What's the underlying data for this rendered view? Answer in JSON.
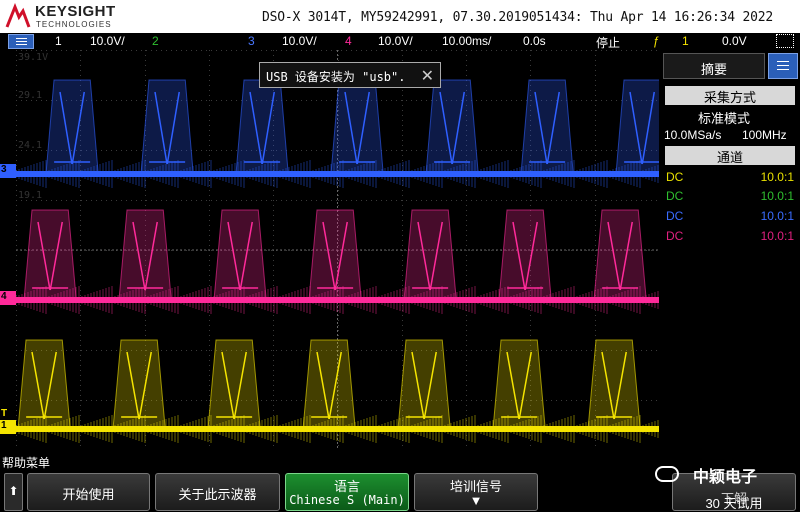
{
  "header": {
    "brand": "KEYSIGHT",
    "brand_sub": "TECHNOLOGIES",
    "info": "DSO-X 3014T, MY59242991, 07.30.2019051434: Thu Apr 14 16:26:34 2022"
  },
  "channel_bar": {
    "ch1_num": "1",
    "ch1_scale": "10.0V/",
    "ch2_num": "2",
    "ch3_num": "3",
    "ch3_scale": "10.0V/",
    "ch4_num": "4",
    "ch4_scale": "10.0V/",
    "timebase": "10.00ms/",
    "delay": "0.0s",
    "run_state": "停止",
    "trigger_icon": "trigger-edge-icon",
    "trigger_source": "1",
    "trigger_level": "0.0V"
  },
  "popup": {
    "message": "USB 设备安装为 \"usb\".",
    "close_glyph": "✕"
  },
  "markers": {
    "ch3": "3",
    "ch4": "4",
    "ch1": "1",
    "trigger": "T"
  },
  "grid_labels": [
    "39.1V",
    "29.1",
    "24.1",
    "19.1"
  ],
  "side_panel": {
    "tab_label": "摘要",
    "acq_header": "采集方式",
    "acq_mode": "标准模式",
    "sample_rate": "10.0MSa/s",
    "bandwidth": "100MHz",
    "channel_header": "通道",
    "channels": [
      {
        "coupling": "DC",
        "ratio": "10.0:1",
        "color": "#e8e000"
      },
      {
        "coupling": "DC",
        "ratio": "10.0:1",
        "color": "#2fbf2f"
      },
      {
        "coupling": "DC",
        "ratio": "10.0:1",
        "color": "#3a6cff"
      },
      {
        "coupling": "DC",
        "ratio": "10.0:1",
        "color": "#e0207f"
      }
    ]
  },
  "bottom": {
    "help_label": "帮助菜单",
    "up_glyph": "⬆",
    "btn_start": "开始使用",
    "btn_about": "关于此示波器",
    "btn_lang_title": "语言",
    "btn_lang_value": "Chinese S (Main)",
    "btn_training_title": "培训信号",
    "btn_training_glyph": "▼",
    "btn_trial_title": "下解",
    "btn_trial_value": "30 天试用",
    "wechat_name": "中颖电子"
  },
  "colors": {
    "ch1": "#f5e400",
    "ch3": "#2f5fff",
    "ch4": "#ff2a9a",
    "accent_blue": "#2b5fb9"
  }
}
